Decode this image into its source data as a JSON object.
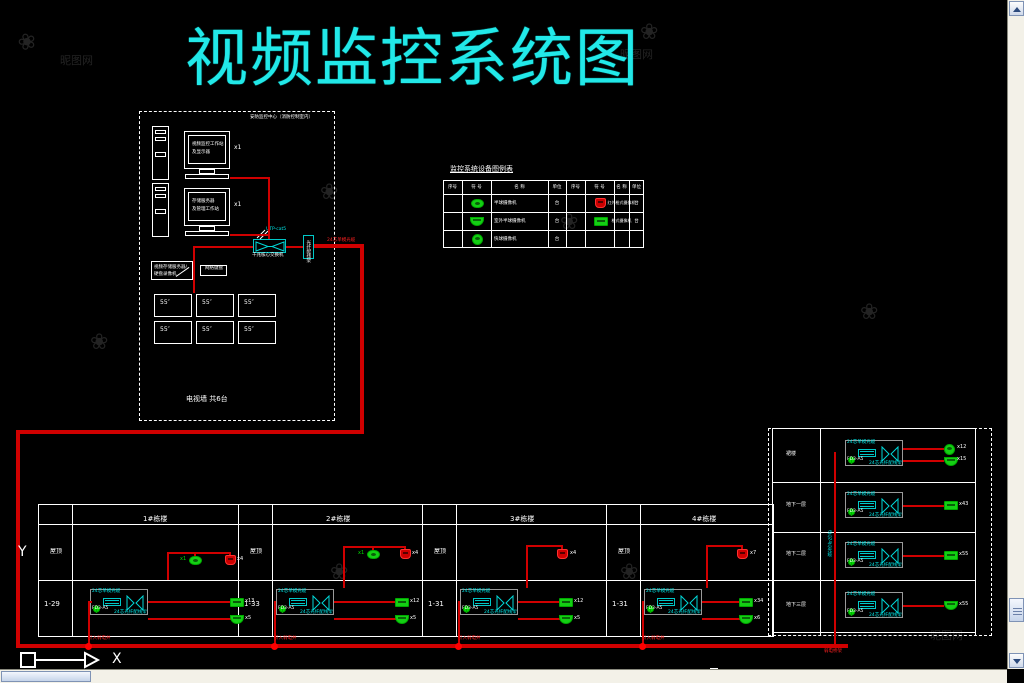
{
  "app": {
    "kind": "cad-drawing-viewer",
    "background": "#000000",
    "accent_cyan": "#00e8e8",
    "accent_red": "#d00000",
    "accent_green": "#14cf14"
  },
  "drawing": {
    "title": "视频监控系统图",
    "title_color": "#22e8e8"
  },
  "control_room": {
    "header": "安防监控中心（消防控制室内）",
    "workstation_1": {
      "label": "视频监控工作站\n及显示器",
      "qty": "x1"
    },
    "workstation_2": {
      "label": "存储服务器\n及管理工作站",
      "qty": "x1"
    },
    "nvr": {
      "label": "视频存储服务器/\n硬盘录像机",
      "side_label": "网络键盘"
    },
    "cable_label": "UTP-cat5",
    "switch": {
      "label": "千兆核心交换机"
    },
    "odf": {
      "label": "光纤配线架"
    },
    "riser_label": "24芯单模光缆",
    "tv_wall": {
      "caption": "电视墙 共6台",
      "monitors": [
        "55″",
        "55″",
        "55″",
        "55″",
        "55″",
        "55″"
      ]
    }
  },
  "legend": {
    "title": "监控系统设备图例表",
    "headers": [
      "序号",
      "符  号",
      "名  称",
      "单位",
      "序号",
      "符  号",
      "名  称",
      "单位"
    ],
    "rows": [
      {
        "sym_left": "dome-camera-icon",
        "name_left": "半球摄像机",
        "unit_left": "台",
        "sym_right": "red-camera-icon",
        "name_right": "红外枪式摄像机",
        "unit_right": "台"
      },
      {
        "sym_left": "half-camera-icon",
        "name_left": "室外半球摄像机",
        "unit_left": "台",
        "sym_right": "box-camera-icon",
        "name_right": "枪式摄像机",
        "unit_right": "台"
      },
      {
        "sym_left": "ball-camera-icon",
        "name_left": "快球摄像机",
        "unit_left": "台",
        "sym_right": "",
        "name_right": "",
        "unit_right": ""
      }
    ]
  },
  "towers": {
    "title_suffix": "栋",
    "items": [
      {
        "name": "1#栋楼",
        "floor_label_upper": "屋顶",
        "floor_range": "1-29",
        "roof_green_qty": "x1",
        "roof_red_qty": "x4",
        "switch_top_label": "24芯单模光缆",
        "switch_model": "FD3-A5",
        "switch_bottom_label": "24芯光纤配线架",
        "out_qty_1": "x13",
        "out_qty_2": "x5",
        "bus_label": "引入弱电井"
      },
      {
        "name": "2#栋楼",
        "floor_label_upper": "屋顶",
        "floor_range": "1-33",
        "roof_green_qty": "x1",
        "roof_red_qty": "x4",
        "switch_top_label": "24芯单模光缆",
        "switch_model": "FD3-A5",
        "switch_bottom_label": "24芯光纤配线架",
        "out_qty_1": "x12",
        "out_qty_2": "x5",
        "bus_label": "引入弱电井"
      },
      {
        "name": "3#栋楼",
        "floor_label_upper": "屋顶",
        "floor_range": "1-31",
        "roof_green_qty": "",
        "roof_red_qty": "x4",
        "switch_top_label": "24芯单模光缆",
        "switch_model": "FD3-A5",
        "switch_bottom_label": "24芯光纤配线架",
        "out_qty_1": "x12",
        "out_qty_2": "x5",
        "bus_label": "引入弱电井"
      },
      {
        "name": "4#栋楼",
        "floor_label_upper": "屋顶",
        "floor_range": "1-31",
        "roof_green_qty": "",
        "roof_red_qty": "x7",
        "switch_top_label": "24芯单模光缆",
        "switch_model": "FD3-A5",
        "switch_bottom_label": "24芯光纤配线架",
        "out_qty_1": "x34",
        "out_qty_2": "x6",
        "bus_label": "引入弱电井"
      }
    ]
  },
  "podium": {
    "riser_label": "6芯24芯光缆",
    "bottom_label": "弱电桥架",
    "floors": [
      {
        "name": "裙楼",
        "switch_top_label": "24芯单模光缆",
        "switch_model": "FD3-A5",
        "switch_bottom_label": "24芯光纤配线架",
        "out_qty_1": "x12",
        "out_qty_2": "x15"
      },
      {
        "name": "地下一层",
        "switch_top_label": "24芯单模光缆",
        "switch_model": "FD3-A5",
        "switch_bottom_label": "24芯光纤配线架",
        "out_qty_1": "x43",
        "out_qty_2": ""
      },
      {
        "name": "地下二层",
        "switch_top_label": "24芯单模光缆",
        "switch_model": "FD3-A5",
        "switch_bottom_label": "24芯光纤配线架",
        "out_qty_1": "x55",
        "out_qty_2": ""
      },
      {
        "name": "地下三层",
        "switch_top_label": "24芯单模光缆",
        "switch_model": "FD3-A5",
        "switch_bottom_label": "24芯光纤配线架",
        "out_qty_1": "x55",
        "out_qty_2": ""
      }
    ]
  },
  "ucs": {
    "x_label": "X",
    "y_label": "Y"
  },
  "watermark": {
    "text": "昵图网",
    "mark": "@"
  }
}
